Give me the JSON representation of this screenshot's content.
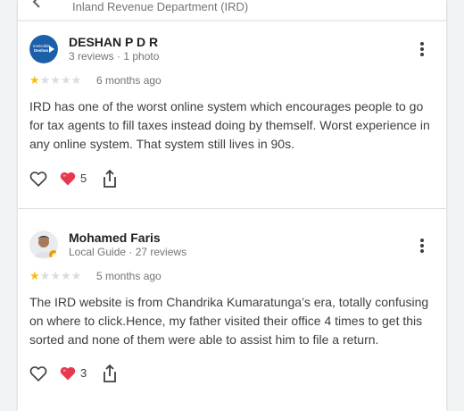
{
  "header": {
    "subtitle": "Inland Revenue Department (IRD)"
  },
  "reviews": [
    {
      "name": "DESHAN P D R",
      "meta": "3 reviews · 1 photo",
      "rating": 1,
      "date": "6 months ago",
      "text": "IRD has one of the worst online system which encourages people to go for tax agents to fill taxes instead doing by themself. Worst experience in any online system. That system still lives in 90s.",
      "reaction_count": "5",
      "avatar_text": "Invincible Deshan"
    },
    {
      "name": "Mohamed Faris",
      "meta": "Local Guide · 27 reviews",
      "rating": 1,
      "date": "5 months ago",
      "text": "The IRD website is from Chandrika Kumaratunga’s era, totally confusing on where to click.Hence, my father visited their office 4 times to get this sorted and none of them were able to assist him to file a return.",
      "reaction_count": "3"
    }
  ],
  "colors": {
    "star": "#fbbc04",
    "heart": "#e8384f",
    "avatar1_bg": "#1a5fa8"
  },
  "icons": [
    "back-arrow-icon",
    "more-vert-icon",
    "star-icon",
    "like-heart-icon",
    "red-heart-emoji-icon",
    "share-icon",
    "local-guide-badge-icon"
  ]
}
